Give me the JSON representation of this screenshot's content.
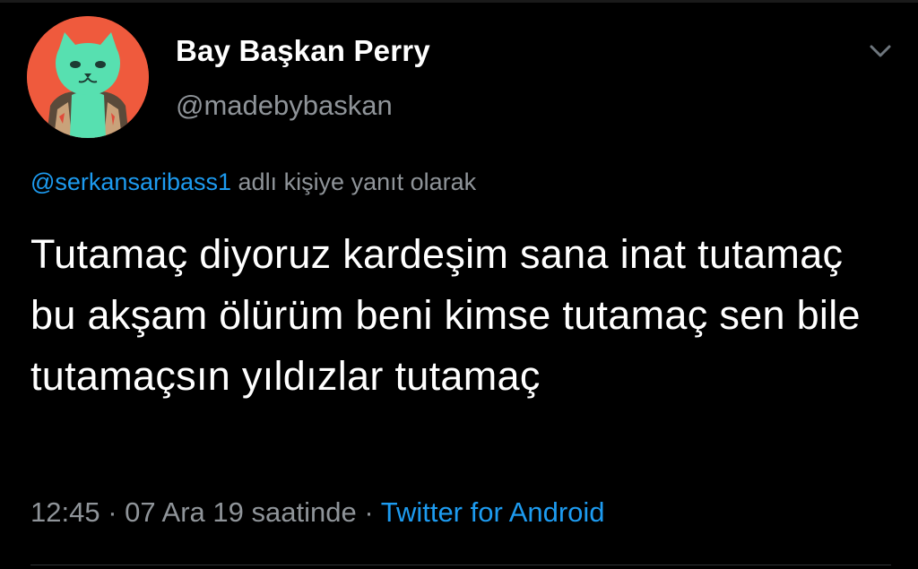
{
  "tweet": {
    "author": {
      "display_name": "Bay Başkan Perry",
      "handle": "@madebybaskan",
      "avatar_icon": "cat-avatar-icon"
    },
    "reply_to": {
      "mention": "@serkansaribass1",
      "suffix": "adlı kişiye yanıt olarak"
    },
    "text": "Tutamaç diyoruz kardeşim sana inat tutamaç bu akşam ölürüm beni kimse tutamaç sen bile tutamaçsın yıldızlar tutamaç",
    "meta": {
      "time": "12:45",
      "separator": "·",
      "date": "07 Ara 19 saatinde",
      "source": "Twitter for Android"
    },
    "menu_icon": "chevron-down-icon"
  },
  "colors": {
    "background": "#000000",
    "text_primary": "#ffffff",
    "text_secondary": "#8f9499",
    "link": "#1d9bf0",
    "avatar_bg": "#ef5a3d",
    "avatar_cat": "#57e0b0"
  }
}
